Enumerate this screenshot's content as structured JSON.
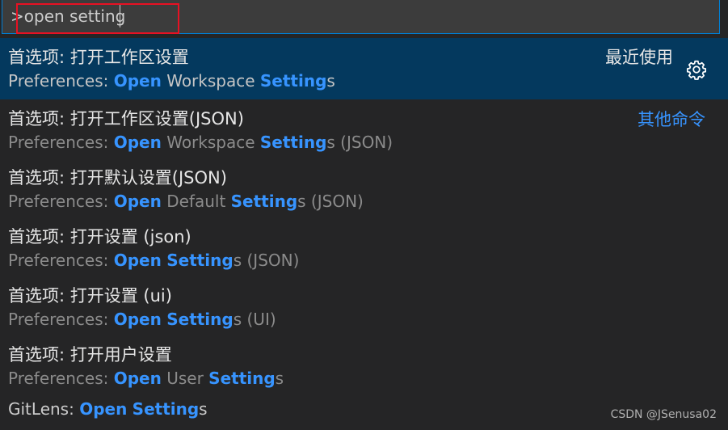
{
  "input": {
    "value": ">open setting"
  },
  "items": [
    {
      "label": "首选项: 打开工作区设置",
      "detail": {
        "prefix": "Preferences: ",
        "open": "Open",
        "mid": " Workspace ",
        "settings": "Setting",
        "suffix": "s"
      },
      "side": "最近使用",
      "selected": true
    },
    {
      "label": "首选项: 打开工作区设置(JSON)",
      "detail": {
        "prefix": "Preferences: ",
        "open": "Open",
        "mid": " Workspace ",
        "settings": "Setting",
        "suffix": "s (JSON)"
      },
      "side": "其他命令"
    },
    {
      "label": "首选项: 打开默认设置(JSON)",
      "detail": {
        "prefix": "Preferences: ",
        "open": "Open",
        "mid": " Default ",
        "settings": "Setting",
        "suffix": "s (JSON)"
      }
    },
    {
      "label": "首选项: 打开设置 (json)",
      "detail": {
        "prefix": "Preferences: ",
        "open": "Open",
        "mid": " ",
        "settings": "Setting",
        "suffix": "s (JSON)"
      }
    },
    {
      "label": "首选项: 打开设置 (ui)",
      "detail": {
        "prefix": "Preferences: ",
        "open": "Open",
        "mid": " ",
        "settings": "Setting",
        "suffix": "s (UI)"
      }
    },
    {
      "label": "首选项: 打开用户设置",
      "detail": {
        "prefix": "Preferences: ",
        "open": "Open",
        "mid": " User ",
        "settings": "Setting",
        "suffix": "s"
      }
    },
    {
      "label": {
        "prefix": "GitLens: ",
        "open": "Open",
        "mid": " ",
        "settings": "Setting",
        "suffix": "s"
      }
    }
  ],
  "watermark": "CSDN @JSenusa02",
  "icons": {
    "gear": "gear-icon"
  },
  "colors": {
    "accent": "#3794ff",
    "selected_bg": "#04395e",
    "annotation_box": "#e81123"
  }
}
